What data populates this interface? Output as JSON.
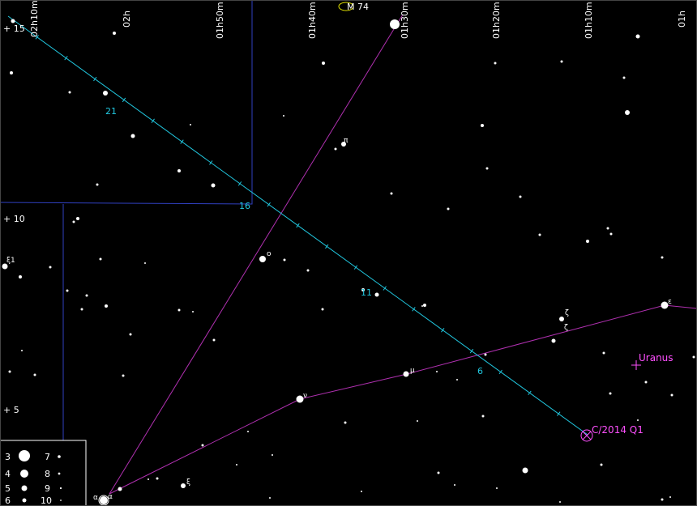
{
  "ra_labels": [
    "02h10m",
    "02h",
    "01h50m",
    "01h40m",
    "01h30m",
    "01h20m",
    "01h10m",
    "01h"
  ],
  "dec_labels": [
    "+ 15",
    "+ 10",
    "+ 5"
  ],
  "comet": {
    "name": "C/2014 Q1",
    "date_ticks": [
      "21",
      "16",
      "11",
      "6"
    ]
  },
  "planet": {
    "name": "Uranus"
  },
  "cluster": {
    "name": "M 74"
  },
  "star_labels": [
    "π",
    "ο",
    "ν",
    "μ",
    "ζ",
    "ζ",
    "ε",
    "ξ",
    "α",
    "α",
    "ξ1"
  ],
  "legend": {
    "magnitudes": [
      "3",
      "4",
      "5",
      "6",
      "7",
      "8",
      "9",
      "10"
    ]
  },
  "colors": {
    "background": "#000000",
    "comet_path": "#21c8e0",
    "constellation_lines": "#c040c0",
    "boundary_lines": "#3040c0",
    "planet": "#ff4fff",
    "cluster": "#ffff00"
  }
}
